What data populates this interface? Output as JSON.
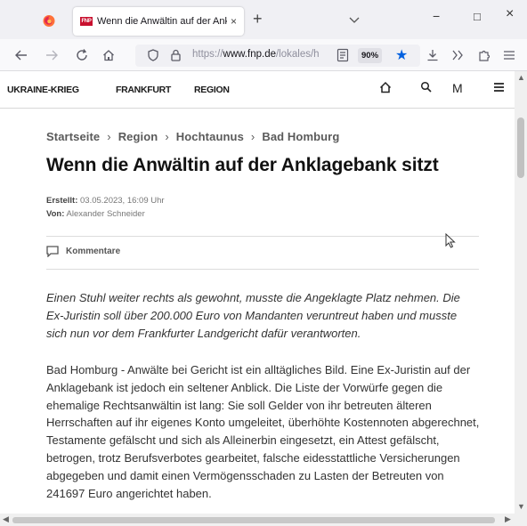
{
  "browser": {
    "tab": {
      "favicon_text": "FNP",
      "title": "Wenn die Anwältin auf der Ankl",
      "close": "×"
    },
    "new_tab": "+",
    "window": {
      "minimize": "−",
      "maximize": "□",
      "close": "×"
    },
    "url": {
      "scheme": "https://",
      "host": "www.fnp.de",
      "path": "/lokales/h"
    },
    "zoom": "90%",
    "colors": {
      "accent": "#0060df",
      "tab_strip": "#f0f0f4"
    }
  },
  "site": {
    "nav": [
      "UKRAINE-KRIEG",
      "FRANKFURT",
      "REGION"
    ],
    "icons": [
      "home-icon",
      "search-icon",
      "merkliste-icon",
      "menu-icon"
    ],
    "merkliste_label": "M"
  },
  "article": {
    "breadcrumb": [
      "Startseite",
      "Region",
      "Hochtaunus",
      "Bad Homburg"
    ],
    "breadcrumb_sep": "›",
    "title": "Wenn die Anwältin auf der Anklagebank sitzt",
    "created_label": "Erstellt:",
    "created_value": "03.05.2023, 16:09 Uhr",
    "author_label": "Von:",
    "author_value": "Alexander Schneider",
    "comments_label": "Kommentare",
    "lead": "Einen Stuhl weiter rechts als gewohnt, musste die Angeklagte Platz nehmen. Die Ex-Juristin soll über 200.000 Euro von Mandanten veruntreut haben und musste sich nun vor dem Frankfurter Landgericht dafür verantworten.",
    "body": "Bad Homburg - Anwälte bei Gericht ist ein alltägliches Bild. Eine Ex-Juristin auf der Anklagebank ist jedoch ein seltener Anblick. Die Liste der Vorwürfe gegen die ehemalige Rechtsanwältin ist lang: Sie soll Gelder von ihr betreuten älteren Herrschaften auf ihr eigenes Konto umgeleitet, überhöhte Kostennoten abgerechnet, Testamente gefälscht und sich als Alleinerbin eingesetzt, ein Attest gefälscht, betrogen, trotz Berufsverbotes gearbeitet, falsche eidesstattliche Versicherungen abgegeben und damit einen Vermögensschaden zu Lasten der Betreuten von 241697 Euro angerichtet haben."
  }
}
